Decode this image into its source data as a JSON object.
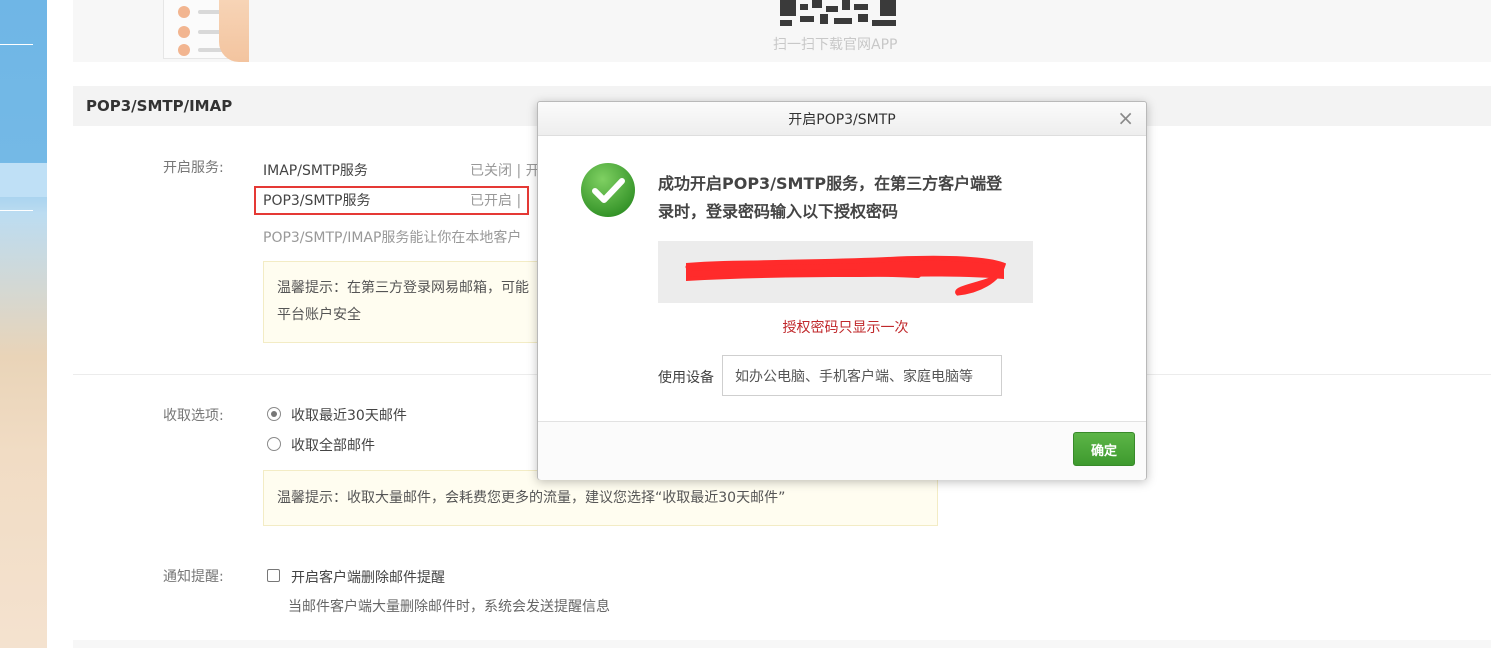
{
  "promo": {
    "qr_caption": "扫一扫下载官网APP"
  },
  "section": {
    "title": "POP3/SMTP/IMAP"
  },
  "services": {
    "label": "开启服务:",
    "items": [
      {
        "name": "IMAP/SMTP服务",
        "status": "已关闭 | 开"
      },
      {
        "name": "POP3/SMTP服务",
        "status": "已开启 | "
      }
    ],
    "description": "POP3/SMTP/IMAP服务能让你在本地客户",
    "tip": {
      "line1": "温馨提示：在第三方登录网易邮箱，可能",
      "line2": "平台账户安全"
    }
  },
  "fetch": {
    "label": "收取选项:",
    "options": [
      {
        "label": "收取最近30天邮件",
        "selected": true
      },
      {
        "label": "收取全部邮件",
        "selected": false
      }
    ],
    "tip": "温馨提示：收取大量邮件，会耗费您更多的流量，建议您选择“收取最近30天邮件”"
  },
  "notify": {
    "label": "通知提醒:",
    "checkbox_label": "开启客户端删除邮件提醒",
    "hint": "当邮件客户端大量删除邮件时，系统会发送提醒信息"
  },
  "dialog": {
    "title": "开启POP3/SMTP",
    "close": "×",
    "success_icon": "check-circle-icon",
    "message_line1": "成功开启POP3/SMTP服务，在第三方客户端登",
    "message_line2": "录时，登录密码输入以下授权密码",
    "auth_code_note": "授权密码只显示一次",
    "device_label": "使用设备",
    "device_placeholder": "如办公电脑、手机客户端、家庭电脑等",
    "confirm": "确定"
  },
  "colors": {
    "accent_green": "#4aa83a",
    "highlight_red": "#e53935",
    "note_red": "#c0282b"
  }
}
